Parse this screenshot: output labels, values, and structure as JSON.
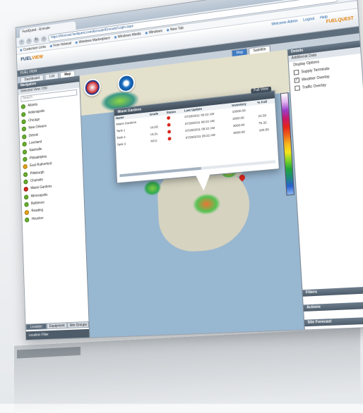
{
  "browser": {
    "tab_title": "FuelQuest - Enroute",
    "url": "https://forecast.fuelquest.com/Enroute/Enroute/Login.aspx",
    "bookmarks": [
      "Customize Links",
      "Free Hotmail",
      "Windows Marketplace",
      "Windows Media",
      "Windows",
      "New Tab"
    ]
  },
  "app": {
    "logo_prefix": "FUEL",
    "logo_suffix": "VIEW",
    "user_links": [
      "Welcome Admin",
      "Logout",
      "Help"
    ],
    "brand": "FUELQUEST",
    "mode_bar": "FUEL VIEW",
    "subtabs": [
      "Dashboard",
      "List",
      "Map"
    ],
    "active_subtab": "Map",
    "map_types": [
      "Map",
      "Satellite"
    ],
    "active_map_type": "Map"
  },
  "navigation": {
    "title": "Navigation",
    "filter": "Selected View: OSI",
    "search_placeholder": "Search",
    "locations": [
      {
        "name": "Atlanta",
        "status": "green"
      },
      {
        "name": "Indianapolis",
        "status": "green"
      },
      {
        "name": "Chicago",
        "status": "green"
      },
      {
        "name": "New Orleans",
        "status": "green"
      },
      {
        "name": "Detroit",
        "status": "green"
      },
      {
        "name": "Loveland",
        "status": "green"
      },
      {
        "name": "Nashville",
        "status": "green"
      },
      {
        "name": "Philadelphia",
        "status": "green"
      },
      {
        "name": "East Rutherford",
        "status": "orange"
      },
      {
        "name": "Pittsburgh",
        "status": "green"
      },
      {
        "name": "Charlotte",
        "status": "green"
      },
      {
        "name": "Miami Gardens",
        "status": "red"
      },
      {
        "name": "Minneapolis",
        "status": "green"
      },
      {
        "name": "Baltimore",
        "status": "green"
      },
      {
        "name": "Reading",
        "status": "orange"
      },
      {
        "name": "Houston",
        "status": "green"
      }
    ],
    "bottom_tabs": [
      "Location",
      "Equipment",
      "Site Groups"
    ],
    "active_bottom_tab": "Location",
    "footer": "Location Filter"
  },
  "popup": {
    "title": "Miami Gardens",
    "full_view_label": "Full View",
    "columns": [
      "Name",
      "Grade",
      "Status",
      "Last Update",
      "Inventory",
      "% Full"
    ],
    "rows": [
      {
        "name": "Miami Gardens",
        "grade": "",
        "status": "red",
        "last_update": "07/28/2011 08:22 AM",
        "inventory": "10000.00",
        "pct": ""
      },
      {
        "name": "Tank 1",
        "grade": "ULSD",
        "status": "red",
        "last_update": "07/28/2011 08:22 AM",
        "inventory": "2000.00",
        "pct": "22.50"
      },
      {
        "name": "Tank 2",
        "grade": "ULSL",
        "status": "red",
        "last_update": "07/28/2011 08:22 AM",
        "inventory": "3000.00",
        "pct": "75.32"
      },
      {
        "name": "Tank 3",
        "grade": "RFG",
        "status": "red",
        "last_update": "07/28/2011 08:22 AM",
        "inventory": "5000.00",
        "pct": "100.50"
      }
    ]
  },
  "details": {
    "title": "Details",
    "section": "Additional Data",
    "display_options_label": "Display Options",
    "options": [
      {
        "label": "Supply Terminals",
        "checked": false
      },
      {
        "label": "Weather Overlay",
        "checked": true
      },
      {
        "label": "Traffic Overlay",
        "checked": false
      }
    ],
    "lower_panels": [
      "Filters",
      "Actions",
      "Site Forecast"
    ]
  },
  "colors": {
    "accent": "#3d7bc4",
    "brand_orange": "#e17c00",
    "status_green": "#6aae2f",
    "status_red": "#d9261c",
    "status_orange": "#e8a317"
  }
}
